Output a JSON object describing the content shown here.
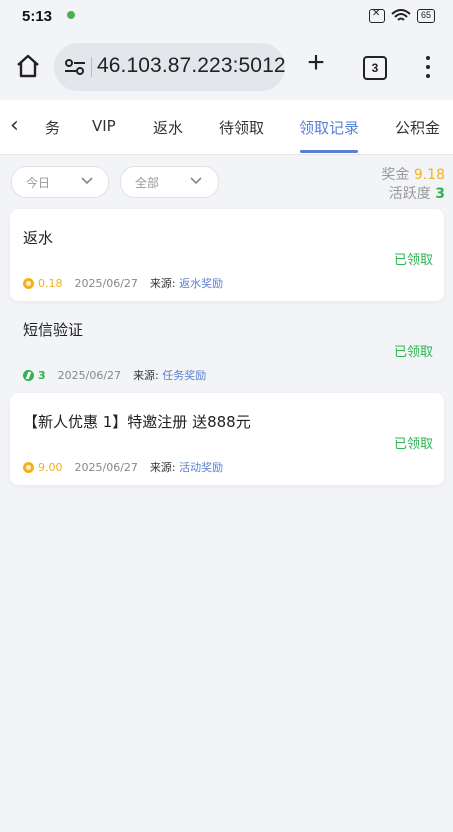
{
  "status_bar": {
    "time": "5:13",
    "battery": "65"
  },
  "browser": {
    "url": "46.103.87.223:5012",
    "tab_count": "3"
  },
  "tabs": [
    {
      "label": "务"
    },
    {
      "label": "VIP"
    },
    {
      "label": "返水"
    },
    {
      "label": "待领取"
    },
    {
      "label": "领取记录",
      "active": true
    },
    {
      "label": "公积金"
    }
  ],
  "filters": {
    "date": "今日",
    "type": "全部"
  },
  "summary": {
    "bonus_label": "奖金",
    "bonus_value": "9.18",
    "activity_label": "活跃度",
    "activity_value": "3"
  },
  "records": [
    {
      "title": "返水",
      "status": "已领取",
      "amount": "0.18",
      "amount_type": "coin",
      "date": "2025/06/27",
      "source_label": "来源:",
      "source": "返水奖励"
    },
    {
      "title": "短信验证",
      "status": "已领取",
      "amount": "3",
      "amount_type": "activity",
      "date": "2025/06/27",
      "source_label": "来源:",
      "source": "任务奖励"
    },
    {
      "title": "【新人优惠 1】特邀注册 送888元",
      "status": "已领取",
      "amount": "9.00",
      "amount_type": "coin",
      "date": "2025/06/27",
      "source_label": "来源:",
      "source": "活动奖励"
    }
  ],
  "colors": {
    "accent": "#5b7fd1",
    "gold": "#f5b021",
    "green": "#2fb450"
  }
}
